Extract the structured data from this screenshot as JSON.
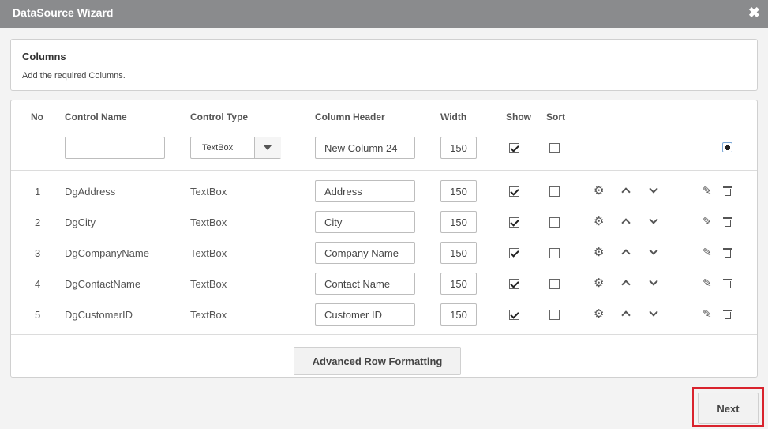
{
  "window": {
    "title": "DataSource Wizard",
    "close_icon": "✖"
  },
  "columns_panel": {
    "title": "Columns",
    "description": "Add the required Columns."
  },
  "table": {
    "headers": {
      "no": "No",
      "control_name": "Control Name",
      "control_type": "Control Type",
      "column_header": "Column Header",
      "width": "Width",
      "show": "Show",
      "sort": "Sort"
    },
    "new_row": {
      "control_name": "",
      "control_type": "TextBox",
      "column_header": "New Column 24",
      "width": "150",
      "show": true,
      "sort": false
    },
    "rows": [
      {
        "no": "1",
        "control_name": "DgAddress",
        "control_type": "TextBox",
        "column_header": "Address",
        "width": "150",
        "show": true,
        "sort": false
      },
      {
        "no": "2",
        "control_name": "DgCity",
        "control_type": "TextBox",
        "column_header": "City",
        "width": "150",
        "show": true,
        "sort": false
      },
      {
        "no": "3",
        "control_name": "DgCompanyName",
        "control_type": "TextBox",
        "column_header": "Company Name",
        "width": "150",
        "show": true,
        "sort": false
      },
      {
        "no": "4",
        "control_name": "DgContactName",
        "control_type": "TextBox",
        "column_header": "Contact Name",
        "width": "150",
        "show": true,
        "sort": false
      },
      {
        "no": "5",
        "control_name": "DgCustomerID",
        "control_type": "TextBox",
        "column_header": "Customer ID",
        "width": "150",
        "show": true,
        "sort": false
      }
    ]
  },
  "icons": {
    "gear": "⚙",
    "pencil": "✎"
  },
  "buttons": {
    "advanced_row_formatting": "Advanced Row Formatting",
    "next": "Next"
  },
  "colors": {
    "titlebar": "#8a8b8d",
    "highlight": "#d9232d"
  }
}
